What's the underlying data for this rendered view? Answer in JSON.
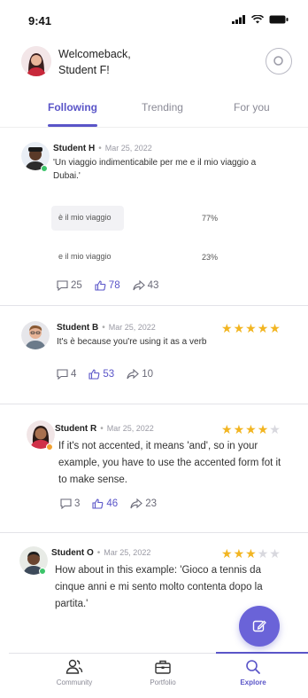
{
  "status_bar": {
    "time": "9:41"
  },
  "header": {
    "greeting_line1": "Welcomeback,",
    "greeting_line2": "Student F!"
  },
  "tabs": [
    {
      "label": "Following",
      "active": true
    },
    {
      "label": "Trending",
      "active": false
    },
    {
      "label": "For you",
      "active": false
    }
  ],
  "posts": [
    {
      "author": "Student H",
      "date": "Mar 25, 2022",
      "text": "'Un viaggio indimenticabile per me e il mio viaggio a Dubai.'",
      "poll": [
        {
          "label": "è il mio viaggio",
          "percent": "77%",
          "fraction": 0.77
        },
        {
          "label": "e il mio viaggio",
          "percent": "23%",
          "fraction": 0.23
        }
      ],
      "comments": "25",
      "likes": "78",
      "shares": "43"
    },
    {
      "author": "Student B",
      "date": "Mar 25, 2022",
      "rating": 5,
      "text": "It's è because you're using it as a verb",
      "comments": "4",
      "likes": "53",
      "shares": "10"
    },
    {
      "author": "Student R",
      "date": "Mar 25, 2022",
      "rating": 4,
      "text": "If it's not accented, it means 'and', so in your example, you have to use the accented form fot it to make sense.",
      "comments": "3",
      "likes": "46",
      "shares": "23"
    },
    {
      "author": "Student O",
      "date": "Mar 25, 2022",
      "rating": 3,
      "text": "How about in this example: 'Gioco a tennis da cinque anni e mi sento molto contenta dopo la partita.'"
    }
  ],
  "bottom_nav": [
    {
      "label": "Community",
      "icon": "community-icon",
      "active": false
    },
    {
      "label": "Portfolio",
      "icon": "portfolio-icon",
      "active": false
    },
    {
      "label": "Explore",
      "icon": "explore-icon",
      "active": true
    }
  ],
  "colors": {
    "accent": "#5a55c8",
    "fab": "#6a63d8",
    "star": "#f2b521",
    "online_green": "#3cc46a",
    "away_orange": "#f2a231"
  }
}
